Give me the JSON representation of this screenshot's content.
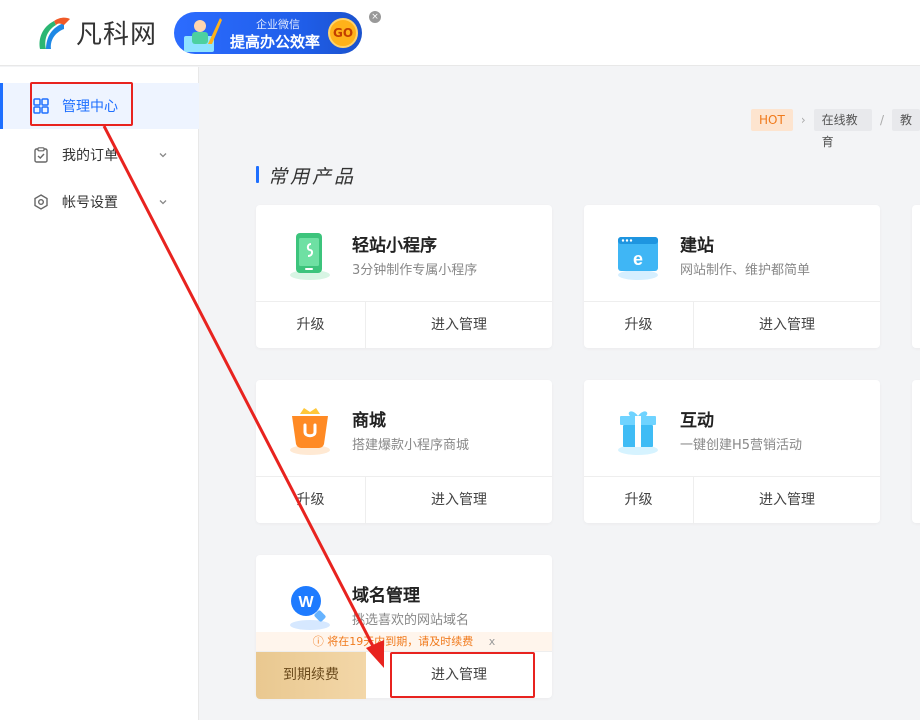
{
  "brand": {
    "name": "凡科网"
  },
  "banner": {
    "line1": "企业微信",
    "line2": "提高办公效率",
    "go": "GO",
    "close": "×"
  },
  "sidebar": {
    "items": [
      {
        "label": "管理中心",
        "icon": "grid-icon",
        "active": true
      },
      {
        "label": "我的订单",
        "icon": "clipboard-check-icon",
        "active": false
      },
      {
        "label": "帐号设置",
        "icon": "gear-hex-icon",
        "active": false
      }
    ]
  },
  "breadcrumb": {
    "hot": "HOT",
    "item1": "在线教育",
    "item2": "教"
  },
  "section": {
    "title": "常用产品"
  },
  "products": [
    {
      "title": "轻站小程序",
      "desc": "3分钟制作专属小程序",
      "left": "升级",
      "right": "进入管理",
      "icon": "mini-program-phone-icon"
    },
    {
      "title": "建站",
      "desc": "网站制作、维护都简单",
      "left": "升级",
      "right": "进入管理",
      "icon": "website-e-icon"
    },
    {
      "title": "商城",
      "desc": "搭建爆款小程序商城",
      "left": "升级",
      "right": "进入管理",
      "icon": "shopping-basket-icon"
    },
    {
      "title": "互动",
      "desc": "一键创建H5营销活动",
      "left": "升级",
      "right": "进入管理",
      "icon": "gift-box-icon"
    },
    {
      "title": "域名管理",
      "desc": "挑选喜欢的网站域名",
      "left": "到期续费",
      "right": "进入管理",
      "icon": "domain-w-search-icon",
      "warning": "将在19天内到期，请及时续费",
      "warning_close": "x"
    }
  ],
  "colors": {
    "accent": "#1e6fff",
    "hot": "#f07a1c",
    "annotation": "#e8231f"
  }
}
